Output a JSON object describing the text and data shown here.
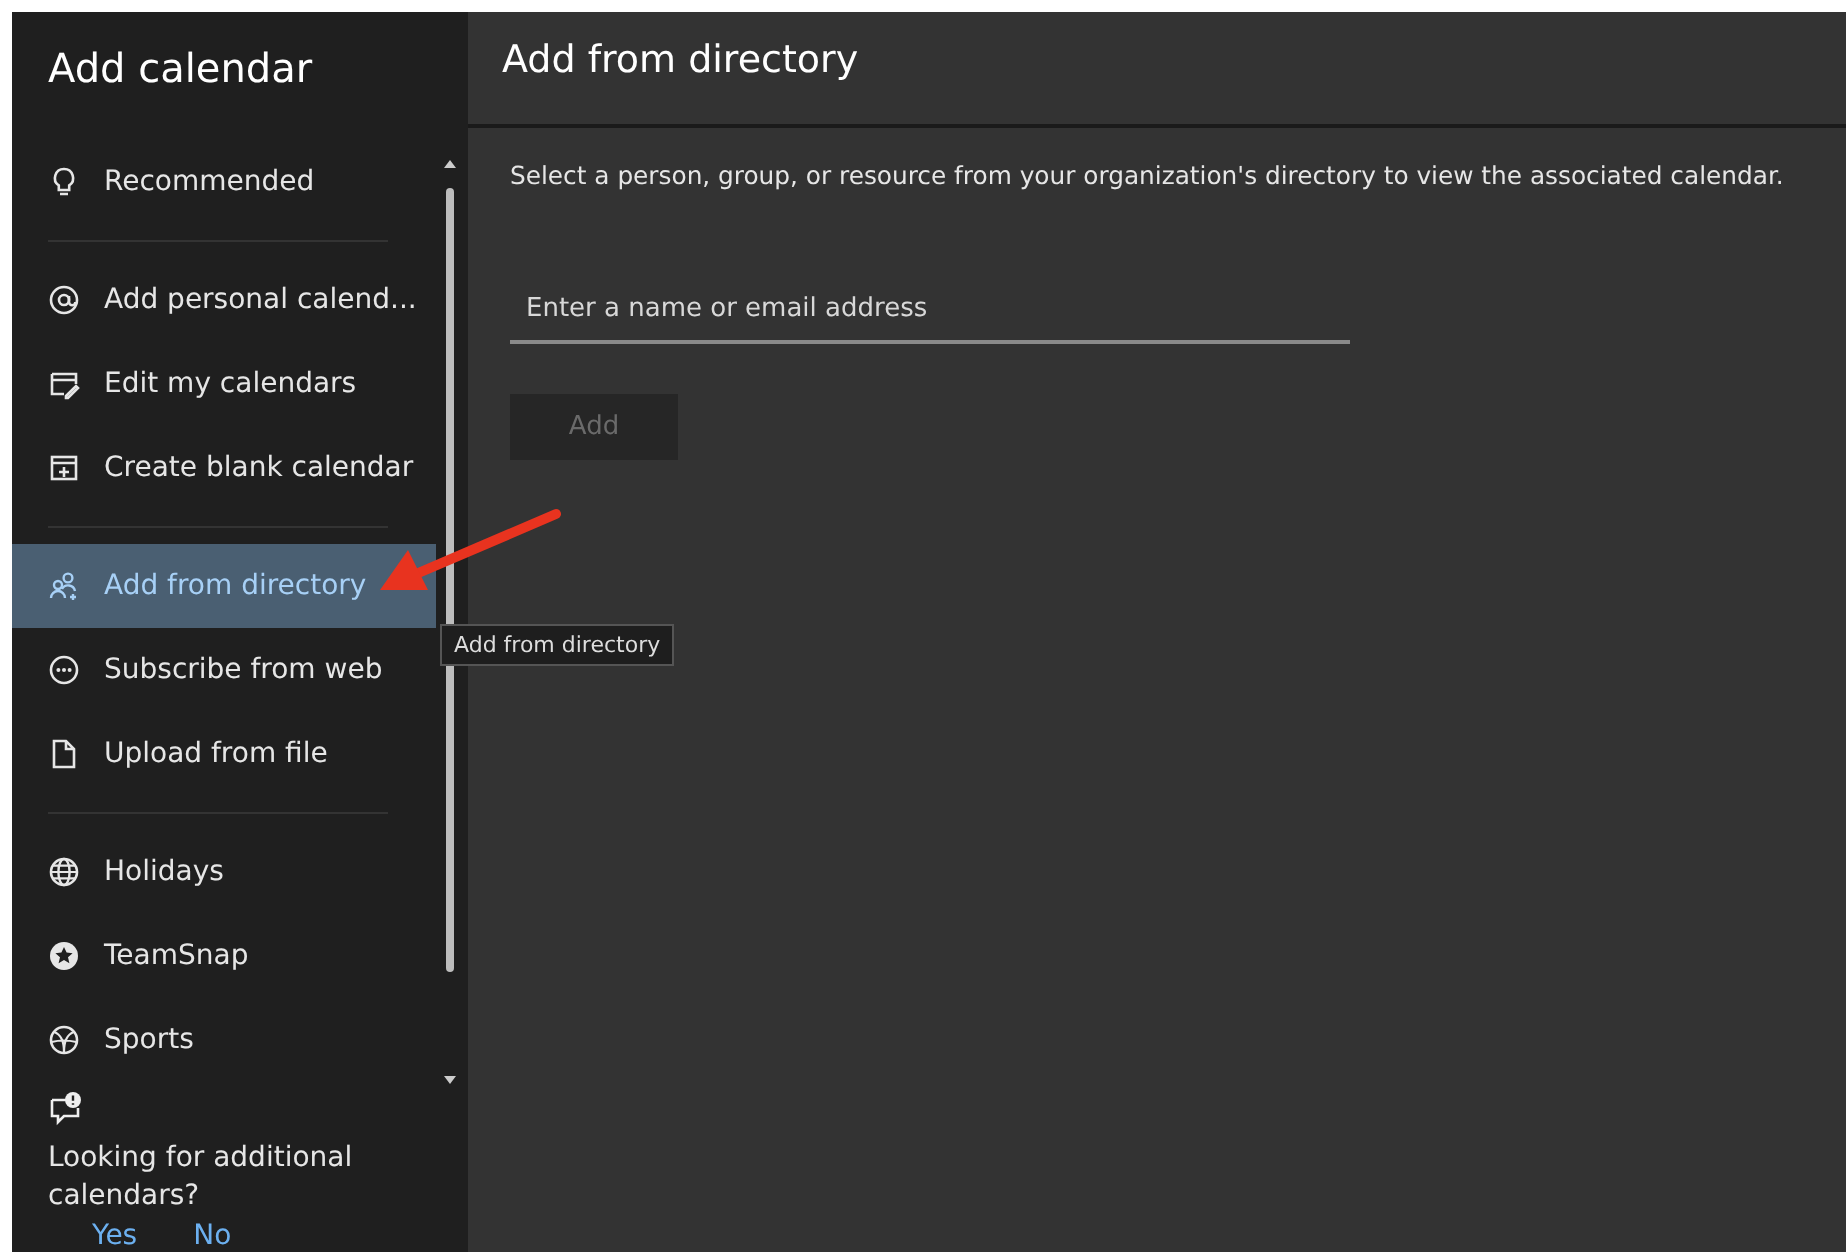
{
  "sidebar": {
    "title": "Add calendar",
    "groups": [
      {
        "items": [
          {
            "label": "Recommended",
            "selected": false
          }
        ]
      },
      {
        "items": [
          {
            "label": "Add personal calend...",
            "selected": false
          },
          {
            "label": "Edit my calendars",
            "selected": false
          },
          {
            "label": "Create blank calendar",
            "selected": false
          }
        ]
      },
      {
        "items": [
          {
            "label": "Add from directory",
            "selected": true
          },
          {
            "label": "Subscribe from web",
            "selected": false
          },
          {
            "label": "Upload from file",
            "selected": false
          }
        ]
      },
      {
        "items": [
          {
            "label": "Holidays",
            "selected": false
          },
          {
            "label": "TeamSnap",
            "selected": false
          },
          {
            "label": "Sports",
            "selected": false
          }
        ]
      }
    ],
    "feedback": {
      "question": "Looking for additional calendars?",
      "yes": "Yes",
      "no": "No"
    }
  },
  "tooltip": "Add from directory",
  "main": {
    "title": "Add from directory",
    "description": "Select a person, group, or resource from your organization's directory to view the associated calendar.",
    "search": {
      "placeholder": "Enter a name or email address"
    },
    "add_button": {
      "label": "Add",
      "disabled": true
    }
  }
}
